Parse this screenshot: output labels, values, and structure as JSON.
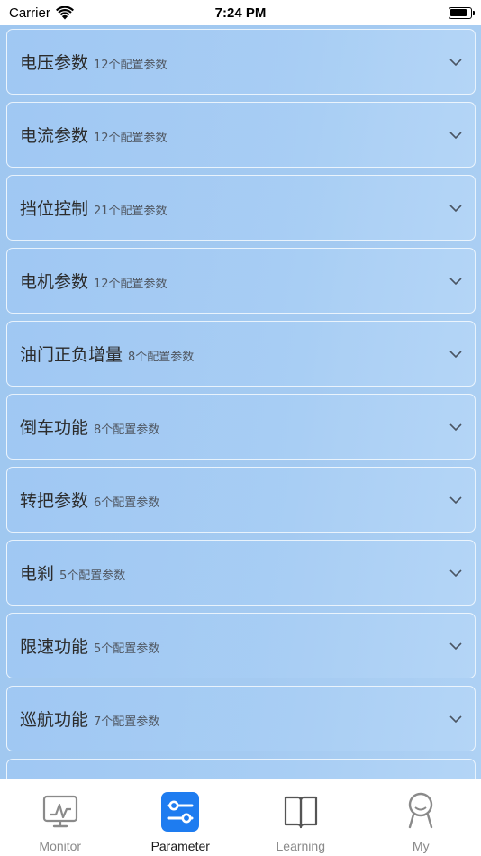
{
  "status_bar": {
    "carrier": "Carrier",
    "time": "7:24 PM"
  },
  "sections": [
    {
      "title": "电压参数",
      "count": "12个配置参数"
    },
    {
      "title": "电流参数",
      "count": "12个配置参数"
    },
    {
      "title": "挡位控制",
      "count": "21个配置参数"
    },
    {
      "title": "电机参数",
      "count": "12个配置参数"
    },
    {
      "title": "油门正负增量",
      "count": "8个配置参数"
    },
    {
      "title": "倒车功能",
      "count": "8个配置参数"
    },
    {
      "title": "转把参数",
      "count": "6个配置参数"
    },
    {
      "title": "电刹",
      "count": "5个配置参数"
    },
    {
      "title": "限速功能",
      "count": "5个配置参数"
    },
    {
      "title": "巡航功能",
      "count": "7个配置参数"
    },
    {
      "title": "",
      "count": ""
    }
  ],
  "tabs": [
    {
      "label": "Monitor",
      "icon": "monitor-icon",
      "active": false
    },
    {
      "label": "Parameter",
      "icon": "sliders-icon",
      "active": true
    },
    {
      "label": "Learning",
      "icon": "book-icon",
      "active": false
    },
    {
      "label": "My",
      "icon": "person-icon",
      "active": false
    }
  ],
  "colors": {
    "accent": "#1e7cf0",
    "background": "#a3c9f1"
  }
}
